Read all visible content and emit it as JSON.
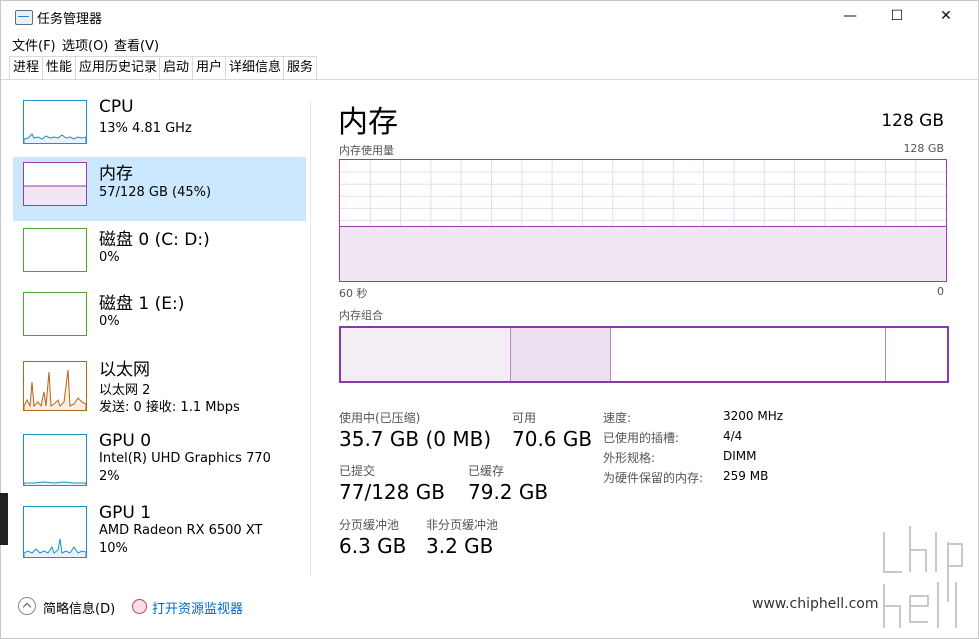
{
  "window": {
    "title": "任务管理器",
    "minimize": "—",
    "maximize": "☐",
    "close": "✕"
  },
  "menu": [
    "文件(F)",
    "选项(O)",
    "查看(V)"
  ],
  "tabs": [
    "进程",
    "性能",
    "应用历史记录",
    "启动",
    "用户",
    "详细信息",
    "服务"
  ],
  "sidebar": {
    "items": [
      {
        "title": "CPU",
        "lines": [
          "13%  4.81 GHz"
        ],
        "color": "#1e90c8"
      },
      {
        "title": "内存",
        "lines": [
          "57/128 GB (45%)"
        ],
        "color": "#9c3ab0"
      },
      {
        "title": "磁盘 0 (C: D:)",
        "lines": [
          "0%"
        ],
        "color": "#4da832"
      },
      {
        "title": "磁盘 1 (E:)",
        "lines": [
          "0%"
        ],
        "color": "#4da832"
      },
      {
        "title": "以太网",
        "lines": [
          "以太网 2",
          "发送: 0  接收: 1.1 Mbps"
        ],
        "color": "#b3651b"
      },
      {
        "title": "GPU 0",
        "lines": [
          "Intel(R) UHD Graphics 770",
          "2%"
        ],
        "color": "#1e90c8"
      },
      {
        "title": "GPU 1",
        "lines": [
          "AMD Radeon RX 6500 XT",
          "10%"
        ],
        "color": "#1e90c8"
      }
    ]
  },
  "main": {
    "title": "内存",
    "total": "128 GB",
    "usage_label": "内存使用量",
    "usage_max": "128 GB",
    "x_left": "60 秒",
    "x_right": "0",
    "composition_label": "内存组合",
    "usage_fraction": 0.45,
    "composition_segments": [
      0.28,
      0.165,
      0.455,
      0.1
    ],
    "stats": {
      "in_use_label": "使用中(已压缩)",
      "in_use": "35.7 GB (0 MB)",
      "available_label": "可用",
      "available": "70.6 GB",
      "committed_label": "已提交",
      "committed": "77/128 GB",
      "cached_label": "已缓存",
      "cached": "79.2 GB",
      "paged_label": "分页缓冲池",
      "paged": "6.3 GB",
      "nonpaged_label": "非分页缓冲池",
      "nonpaged": "3.2 GB"
    },
    "details": [
      {
        "label": "速度:",
        "value": "3200 MHz"
      },
      {
        "label": "已使用的插槽:",
        "value": "4/4"
      },
      {
        "label": "外形规格:",
        "value": "DIMM"
      },
      {
        "label": "为硬件保留的内存:",
        "value": "259 MB"
      }
    ]
  },
  "footer": {
    "fewer_details": "简略信息(D)",
    "open_resmon": "打开资源监视器"
  },
  "watermark": {
    "url": "www.chiphell.com"
  }
}
